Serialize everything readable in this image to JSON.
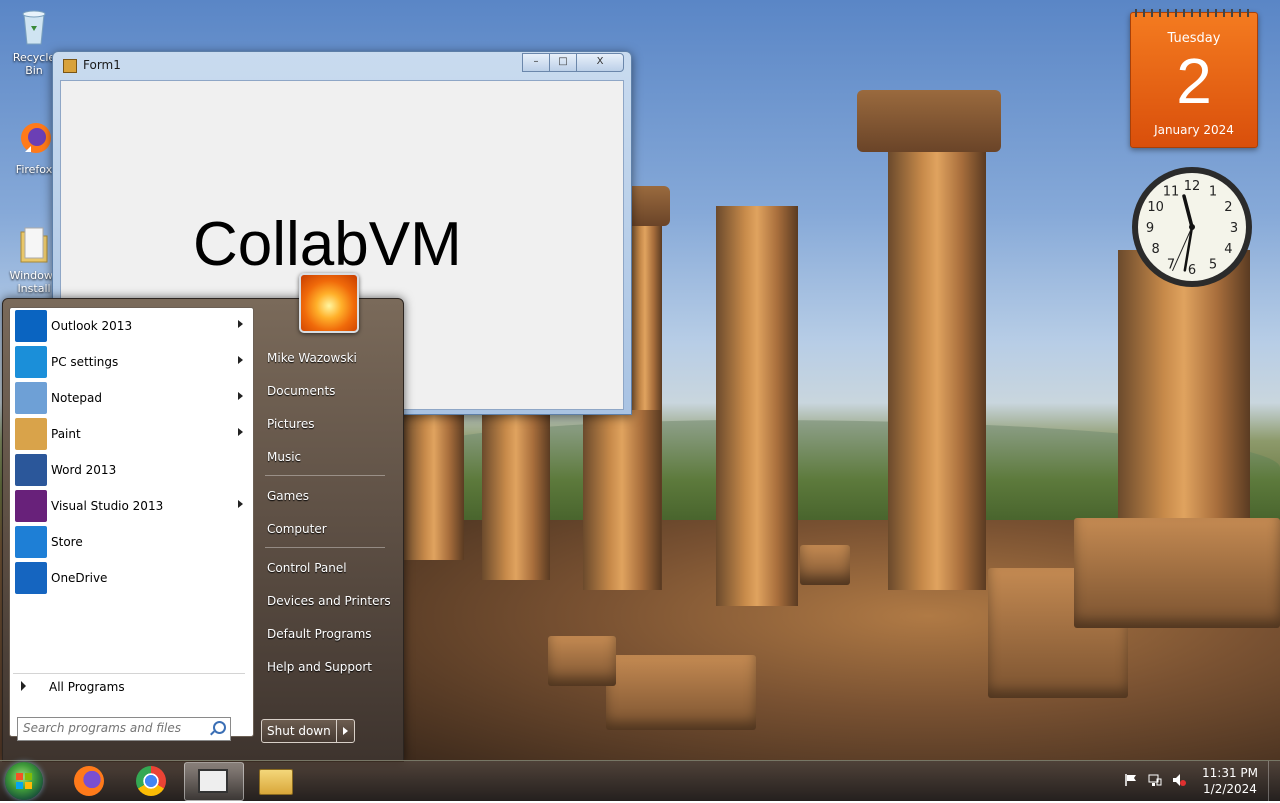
{
  "desktop": {
    "icons": [
      {
        "name": "recycle-bin",
        "label": "Recycle Bin"
      },
      {
        "name": "firefox",
        "label": "Firefox"
      },
      {
        "name": "windows-install",
        "label": "Windows Install"
      }
    ]
  },
  "form1": {
    "title": "Form1",
    "label_text": "CollabVM",
    "controls": {
      "minimize": "–",
      "maximize": "□",
      "close": "X"
    }
  },
  "start_menu": {
    "programs": [
      {
        "label": "Outlook 2013",
        "icon": "outlook-icon",
        "color": "#0a64c1",
        "has_submenu": true
      },
      {
        "label": "PC settings",
        "icon": "gear-icon",
        "color": "#1b8fd9",
        "has_submenu": true
      },
      {
        "label": "Notepad",
        "icon": "notepad-icon",
        "color": "#6ea0d6",
        "has_submenu": true
      },
      {
        "label": "Paint",
        "icon": "paint-palette-icon",
        "color": "#d9a34a",
        "has_submenu": true
      },
      {
        "label": "Word 2013",
        "icon": "word-icon",
        "color": "#2b579a",
        "has_submenu": false
      },
      {
        "label": "Visual Studio 2013",
        "icon": "visual-studio-icon",
        "color": "#68217a",
        "has_submenu": true
      },
      {
        "label": "Store",
        "icon": "store-bag-icon",
        "color": "#1e7fd6",
        "has_submenu": false
      },
      {
        "label": "OneDrive",
        "icon": "onedrive-cloud-icon",
        "color": "#1565c0",
        "has_submenu": false
      }
    ],
    "all_programs": "All Programs",
    "search_placeholder": "Search programs and files",
    "right_items": [
      {
        "label": "Mike Wazowski"
      },
      {
        "label": "Documents"
      },
      {
        "label": "Pictures"
      },
      {
        "label": "Music"
      },
      {
        "label": "Games"
      },
      {
        "label": "Computer"
      },
      {
        "label": "Control Panel"
      },
      {
        "label": "Devices and Printers"
      },
      {
        "label": "Default Programs"
      },
      {
        "label": "Help and Support"
      }
    ],
    "shutdown_label": "Shut down"
  },
  "taskbar": {
    "pinned": [
      {
        "name": "firefox-taskbar-icon"
      },
      {
        "name": "chrome-taskbar-icon"
      },
      {
        "name": "form-app-taskbar-icon"
      },
      {
        "name": "explorer-taskbar-icon"
      }
    ],
    "time": "11:31 PM",
    "date": "1/2/2024"
  },
  "gadgets": {
    "calendar": {
      "day": "Tuesday",
      "date": "2",
      "month": "January 2024"
    },
    "clock": {
      "hour": 11,
      "minute": 31,
      "second": 34
    }
  }
}
